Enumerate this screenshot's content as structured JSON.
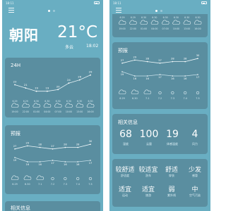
{
  "left": {
    "status_time": "18:11",
    "city": "朝阳",
    "temperature": "21°C",
    "condition": "多云",
    "update_time": "18:02",
    "hourly": {
      "title": "24H",
      "temps": [
        23,
        21,
        19,
        19,
        20,
        24,
        26,
        29
      ],
      "times": [
        "19:00",
        "22:00",
        "01:00",
        "04:00",
        "07:00",
        "10:00",
        "13:00",
        "16:00"
      ],
      "dates": [
        "6.29",
        "6.29",
        "6.30",
        "6.30",
        "6.30",
        "6.30",
        "6.30",
        "6.30"
      ]
    },
    "forecast": {
      "title": "预报",
      "highs": [
        27,
        29,
        28,
        27,
        28,
        28,
        30
      ],
      "lows": [
        19,
        16,
        16,
        17,
        16,
        16,
        17
      ],
      "dates": [
        "6.29",
        "6.30",
        "7.1",
        "7.2",
        "7.3",
        "7.4",
        "7.5"
      ]
    },
    "related_title": "相关信息"
  },
  "right": {
    "status_time": "18:11",
    "top_dates": [
      "6.29",
      "6.29",
      "6.30",
      "6.30",
      "6.30",
      "6.30",
      "6.30",
      "6.30"
    ],
    "top_times": [
      "19:00",
      "22:00",
      "01:00",
      "04:00",
      "07:00",
      "10:00",
      "13:00",
      "16:00"
    ],
    "forecast": {
      "title": "预报",
      "highs": [
        27,
        29,
        28,
        27,
        28,
        28,
        30
      ],
      "lows": [
        19,
        16,
        16,
        17,
        16,
        16,
        17
      ],
      "dates": [
        "6.29",
        "6.30",
        "7.1",
        "7.2",
        "7.3",
        "7.4",
        "7.5"
      ]
    },
    "related": {
      "title": "相关信息",
      "items": [
        {
          "value": "68",
          "label": "湿度"
        },
        {
          "value": "100",
          "label": "云量"
        },
        {
          "value": "19",
          "label": "体感温度"
        },
        {
          "value": "4",
          "label": "风力"
        }
      ]
    },
    "life": {
      "row1": [
        {
          "value": "较舒适",
          "label": "舒适度"
        },
        {
          "value": "较适宜",
          "label": "洗车"
        },
        {
          "value": "舒适",
          "label": "穿衣"
        },
        {
          "value": "少发",
          "label": "感冒"
        }
      ],
      "row2": [
        {
          "value": "适宜",
          "label": "运动"
        },
        {
          "value": "适宜",
          "label": "旅游"
        },
        {
          "value": "弱",
          "label": "紫外线"
        },
        {
          "value": "中",
          "label": "空气污染"
        }
      ]
    }
  }
}
